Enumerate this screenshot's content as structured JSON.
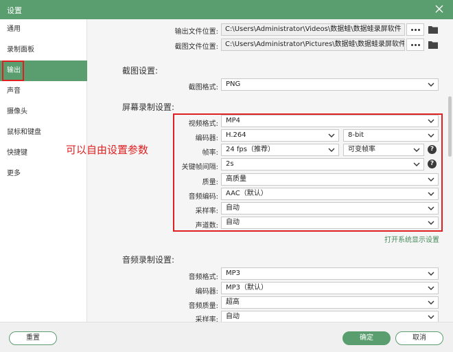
{
  "window": {
    "title": "设置"
  },
  "sidebar": {
    "items": [
      {
        "label": "通用"
      },
      {
        "label": "录制面板"
      },
      {
        "label": "输出"
      },
      {
        "label": "声音"
      },
      {
        "label": "摄像头"
      },
      {
        "label": "鼠标和键盘"
      },
      {
        "label": "快捷键"
      },
      {
        "label": "更多"
      }
    ],
    "active": "输出"
  },
  "output_paths": {
    "video_label": "输出文件位置:",
    "video_path": "C:\\Users\\Administrator\\Videos\\数据蛙\\数据蛙录屏软件",
    "screenshot_label": "截图文件位置:",
    "screenshot_path": "C:\\Users\\Administrator\\Pictures\\数据蛙\\数据蛙录屏软件"
  },
  "screenshot_settings": {
    "heading": "截图设置:",
    "format_label": "截图格式:",
    "format_value": "PNG"
  },
  "screen_recording": {
    "heading": "屏幕录制设置:",
    "video_format_label": "视频格式:",
    "video_format_value": "MP4",
    "encoder_label": "编码器:",
    "encoder_value": "H.264",
    "bit_depth_value": "8-bit",
    "fps_label": "帧率:",
    "fps_value": "24 fps（推荐）",
    "variable_fps_value": "可变帧率",
    "keyframe_label": "关键帧间隔:",
    "keyframe_value": "2s",
    "quality_label": "质量:",
    "quality_value": "高质量",
    "audio_codec_label": "音频编码:",
    "audio_codec_value": "AAC（默认）",
    "sample_rate_label": "采样率:",
    "sample_rate_value": "自动",
    "channels_label": "声道数:",
    "channels_value": "自动",
    "display_settings_link": "打开系统显示设置"
  },
  "annotation": {
    "text": "可以自由设置参数",
    "color": "#e02020"
  },
  "audio_recording": {
    "heading": "音频录制设置:",
    "format_label": "音频格式:",
    "format_value": "MP3",
    "encoder_label": "编码器:",
    "encoder_value": "MP3（默认）",
    "quality_label": "音频质量:",
    "quality_value": "超高",
    "sample_rate_label": "采样率:",
    "sample_rate_value": "自动"
  },
  "footer": {
    "reset_label": "重置",
    "ok_label": "确定",
    "cancel_label": "取消"
  },
  "colors": {
    "accent": "#5a9e6f",
    "highlight": "#e02020",
    "link": "#4a8a5e"
  }
}
